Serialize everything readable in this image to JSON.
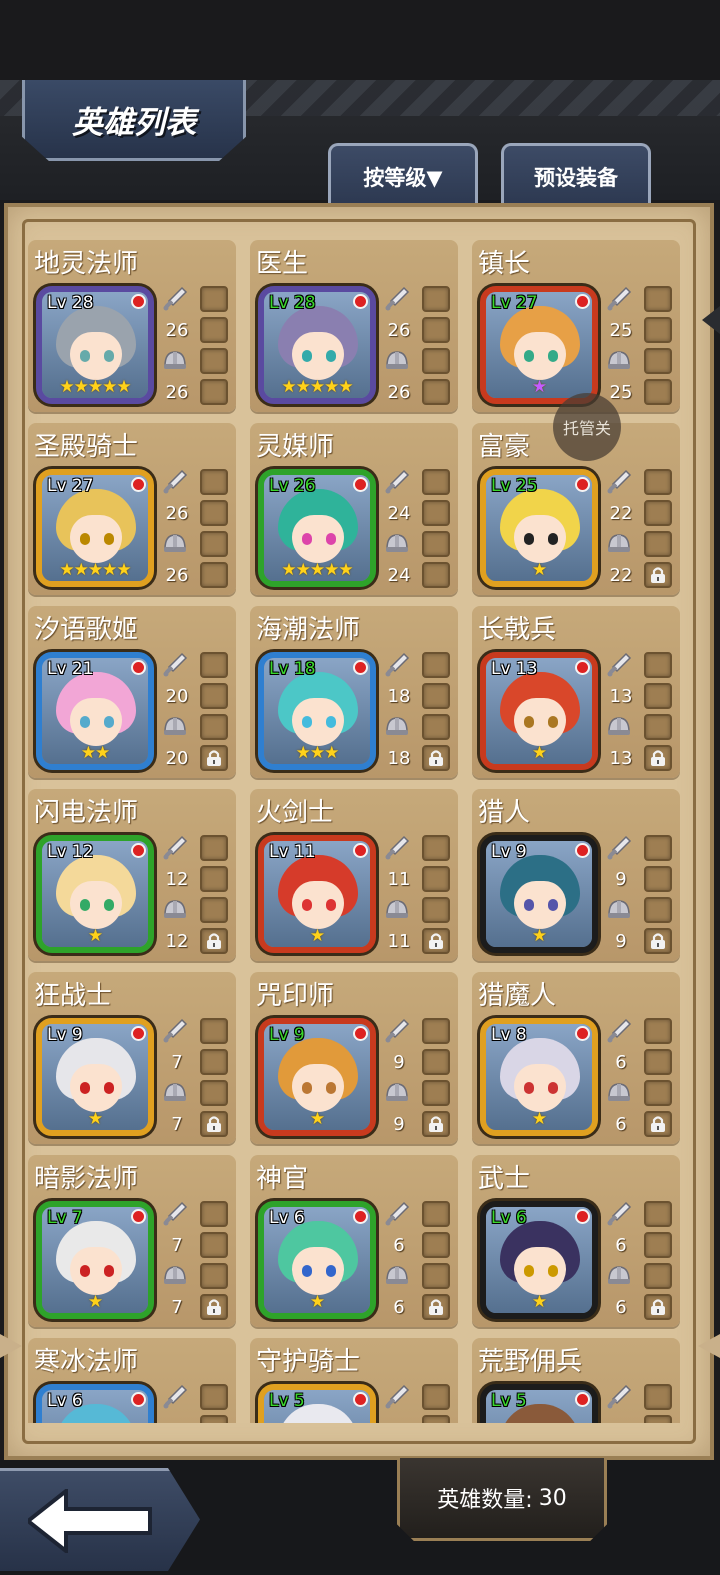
{
  "header": {
    "title": "英雄列表",
    "sort_button": "按等级▼",
    "preset_button": "预设装备"
  },
  "overlay": {
    "toggle_label": "托管关"
  },
  "footer": {
    "hero_count_label": "英雄数量:",
    "hero_count_value": "30"
  },
  "colors": {
    "frame_gold": "#e0a020",
    "frame_purple": "#5a4aa0",
    "frame_red": "#c83a1e",
    "frame_green": "#2ea32a",
    "frame_blue": "#2f7fd0",
    "frame_black": "#1c1c1c"
  },
  "heroes": [
    {
      "name": "地灵法师",
      "level": "Lv 28",
      "lv_green": false,
      "attack": "26",
      "defense": "26",
      "stars": "★★★★★",
      "star_color": "gold",
      "frame": "purple",
      "locked": false
    },
    {
      "name": "医生",
      "level": "Lv 28",
      "lv_green": true,
      "attack": "26",
      "defense": "26",
      "stars": "★★★★★",
      "star_color": "gold",
      "frame": "purple",
      "locked": false
    },
    {
      "name": "镇长",
      "level": "Lv 27",
      "lv_green": true,
      "attack": "25",
      "defense": "25",
      "stars": "★",
      "star_color": "purple",
      "frame": "red",
      "locked": false
    },
    {
      "name": "圣殿骑士",
      "level": "Lv 27",
      "lv_green": false,
      "attack": "26",
      "defense": "26",
      "stars": "★★★★★",
      "star_color": "gold",
      "frame": "gold",
      "locked": false
    },
    {
      "name": "灵媒师",
      "level": "Lv 26",
      "lv_green": true,
      "attack": "24",
      "defense": "24",
      "stars": "★★★★★",
      "star_color": "gold",
      "frame": "green",
      "locked": false
    },
    {
      "name": "富豪",
      "level": "Lv 25",
      "lv_green": true,
      "attack": "22",
      "defense": "22",
      "stars": "★",
      "star_color": "gold",
      "frame": "gold",
      "locked": true
    },
    {
      "name": "汐语歌姬",
      "level": "Lv 21",
      "lv_green": false,
      "attack": "20",
      "defense": "20",
      "stars": "★★",
      "star_color": "gold",
      "frame": "blue",
      "locked": true
    },
    {
      "name": "海潮法师",
      "level": "Lv 18",
      "lv_green": true,
      "attack": "18",
      "defense": "18",
      "stars": "★★★",
      "star_color": "gold",
      "frame": "blue",
      "locked": true
    },
    {
      "name": "长戟兵",
      "level": "Lv 13",
      "lv_green": false,
      "attack": "13",
      "defense": "13",
      "stars": "★",
      "star_color": "gold",
      "frame": "red",
      "locked": true
    },
    {
      "name": "闪电法师",
      "level": "Lv 12",
      "lv_green": false,
      "attack": "12",
      "defense": "12",
      "stars": "★",
      "star_color": "gold",
      "frame": "green",
      "locked": true
    },
    {
      "name": "火剑士",
      "level": "Lv 11",
      "lv_green": false,
      "attack": "11",
      "defense": "11",
      "stars": "★",
      "star_color": "gold",
      "frame": "red",
      "locked": true
    },
    {
      "name": "猎人",
      "level": "Lv 9",
      "lv_green": false,
      "attack": "9",
      "defense": "9",
      "stars": "★",
      "star_color": "gold",
      "frame": "black",
      "locked": true
    },
    {
      "name": "狂战士",
      "level": "Lv 9",
      "lv_green": false,
      "attack": "7",
      "defense": "7",
      "stars": "★",
      "star_color": "gold",
      "frame": "gold",
      "locked": true
    },
    {
      "name": "咒印师",
      "level": "Lv 9",
      "lv_green": true,
      "attack": "9",
      "defense": "9",
      "stars": "★",
      "star_color": "gold",
      "frame": "red",
      "locked": true
    },
    {
      "name": "猎魔人",
      "level": "Lv 8",
      "lv_green": false,
      "attack": "6",
      "defense": "6",
      "stars": "★",
      "star_color": "gold",
      "frame": "gold",
      "locked": true
    },
    {
      "name": "暗影法师",
      "level": "Lv 7",
      "lv_green": true,
      "attack": "7",
      "defense": "7",
      "stars": "★",
      "star_color": "gold",
      "frame": "green",
      "locked": true
    },
    {
      "name": "神官",
      "level": "Lv 6",
      "lv_green": false,
      "attack": "6",
      "defense": "6",
      "stars": "★",
      "star_color": "gold",
      "frame": "green",
      "locked": true
    },
    {
      "name": "武士",
      "level": "Lv 6",
      "lv_green": true,
      "attack": "6",
      "defense": "6",
      "stars": "★",
      "star_color": "gold",
      "frame": "black",
      "locked": true
    },
    {
      "name": "寒冰法师",
      "level": "Lv 6",
      "lv_green": false,
      "attack": "",
      "defense": "",
      "stars": "",
      "star_color": "gold",
      "frame": "blue",
      "locked": false
    },
    {
      "name": "守护骑士",
      "level": "Lv 5",
      "lv_green": true,
      "attack": "",
      "defense": "",
      "stars": "",
      "star_color": "gold",
      "frame": "gold",
      "locked": false
    },
    {
      "name": "荒野佣兵",
      "level": "Lv 5",
      "lv_green": true,
      "attack": "",
      "defense": "",
      "stars": "",
      "star_color": "gold",
      "frame": "black",
      "locked": false
    }
  ]
}
